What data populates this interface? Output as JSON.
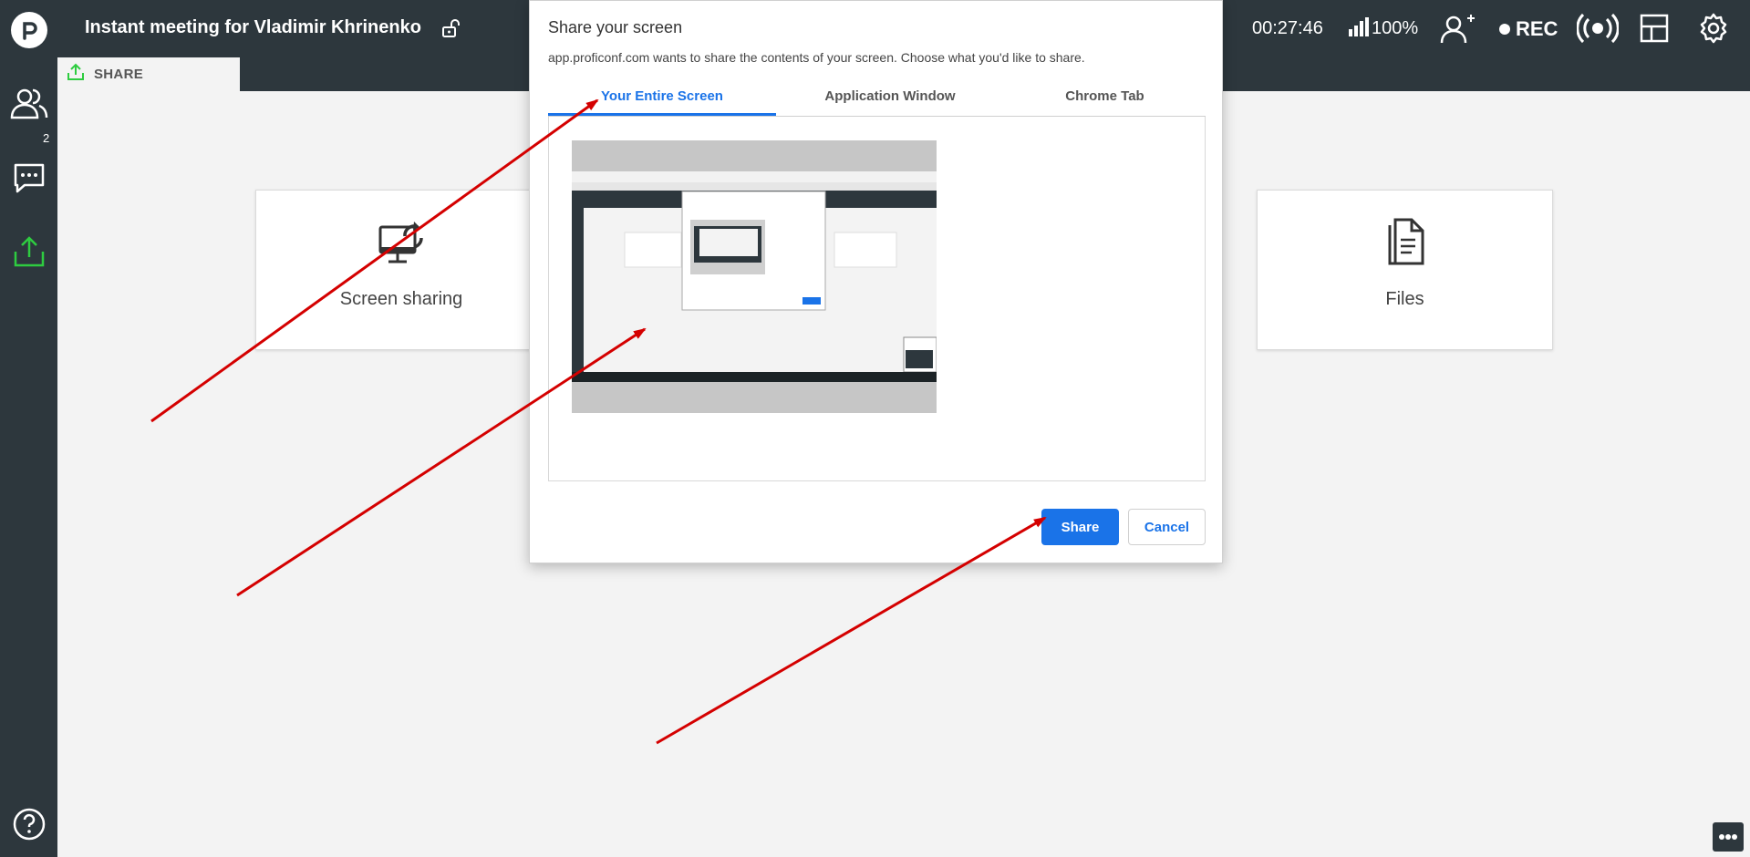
{
  "header": {
    "meeting_title": "Instant meeting for Vladimir Khrinenko",
    "timer": "00:27:46",
    "signal": "100%",
    "rec_label": "REC"
  },
  "sidebar": {
    "participants_count": "2",
    "items": [
      {
        "icon": "participants-icon"
      },
      {
        "icon": "chat-icon"
      },
      {
        "icon": "share-icon"
      }
    ]
  },
  "share_tab": {
    "label": "SHARE"
  },
  "cards": [
    {
      "label": "Screen sharing",
      "icon": "screen-share-icon"
    },
    {
      "label": "Files",
      "icon": "file-icon"
    }
  ],
  "dialog": {
    "title": "Share your screen",
    "description": "app.proficonf.com wants to share the contents of your screen. Choose what you'd like to share.",
    "tabs": [
      {
        "label": "Your Entire Screen",
        "active": true
      },
      {
        "label": "Application Window",
        "active": false
      },
      {
        "label": "Chrome Tab",
        "active": false
      }
    ],
    "share_label": "Share",
    "cancel_label": "Cancel"
  },
  "colors": {
    "topbar": "#2d373d",
    "accent_blue": "#1a73e8",
    "share_green": "#2ecc40",
    "arrow_red": "#d40000"
  }
}
